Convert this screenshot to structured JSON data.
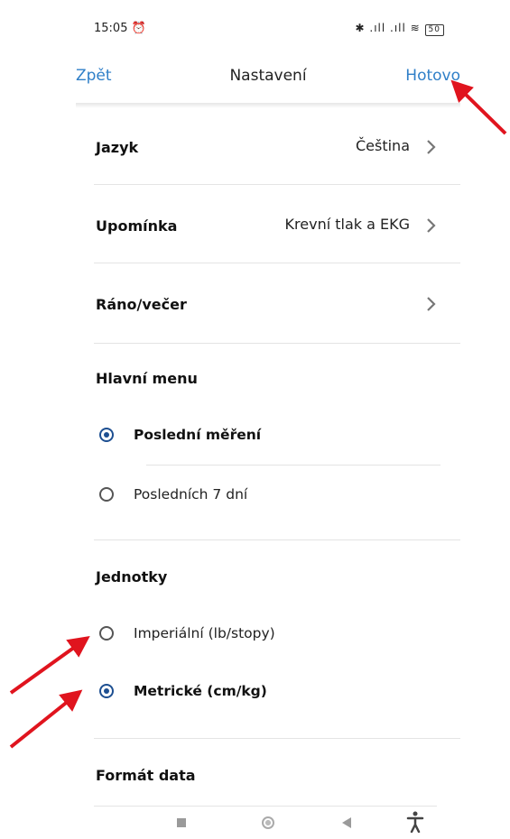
{
  "status": {
    "time": "15:05",
    "battery": "50"
  },
  "nav": {
    "back": "Zpět",
    "title": "Nastavení",
    "done": "Hotovo"
  },
  "rows": [
    {
      "label": "Jazyk",
      "value": "Čeština"
    },
    {
      "label": "Upomínka",
      "value": "Krevní tlak a EKG"
    },
    {
      "label": "Ráno/večer",
      "value": ""
    }
  ],
  "main_menu": {
    "title": "Hlavní menu",
    "options": [
      {
        "label": "Poslední měření",
        "selected": true
      },
      {
        "label": "Posledních 7 dní",
        "selected": false
      }
    ]
  },
  "units": {
    "title": "Jednotky",
    "options": [
      {
        "label": "Imperiální (lb/stopy)",
        "selected": false
      },
      {
        "label": "Metrické (cm/kg)",
        "selected": true
      }
    ]
  },
  "date_format": {
    "title": "Formát data"
  },
  "colors": {
    "accent": "#2f7fc8",
    "radio": "#1d4f91",
    "annotation": "#e0141e"
  }
}
